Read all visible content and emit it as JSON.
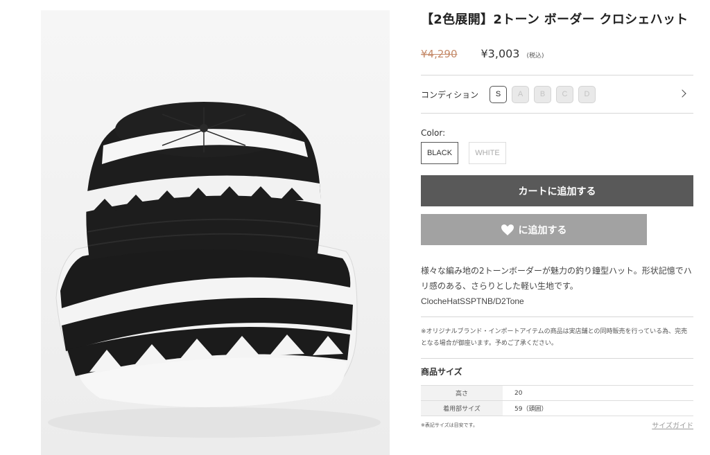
{
  "product": {
    "title": "【2色展開】2トーン ボーダー クロシェハット",
    "price_original": "¥4,290",
    "price_sale": "¥3,003",
    "price_tax_note": "(税込)"
  },
  "condition": {
    "label": "コンディション",
    "options": [
      "S",
      "A",
      "B",
      "C",
      "D"
    ],
    "selected": "S"
  },
  "color": {
    "label": "Color:",
    "options": [
      "BLACK",
      "WHITE"
    ],
    "selected": "BLACK"
  },
  "actions": {
    "cart_label": "カートに追加する",
    "favorite_label": "に追加する",
    "favorite_icon": "heart-icon"
  },
  "description": {
    "text": "様々な編み地の2トーンボーダーが魅力の釣り鐘型ハット。形状記憶でハリ感のある、さらりとした軽い生地です。",
    "sku": "ClocheHatSSPTNB/D2Tone",
    "notice": "※オリジナルブランド・インポートアイテムの商品は実店舗との同時販売を行っている為、完売となる場合が御座います。予めご了承ください。"
  },
  "size": {
    "title": "商品サイズ",
    "rows": [
      {
        "label": "高さ",
        "value": "20"
      },
      {
        "label": "着用部サイズ",
        "value": "59（頭囲）"
      }
    ],
    "note": "※表記サイズは目安です。",
    "guide_label": "サイズガイド"
  },
  "colors": {
    "cart_bg": "#595959",
    "favorite_bg": "#a2a2a2",
    "price_original": "#c58b6a"
  }
}
